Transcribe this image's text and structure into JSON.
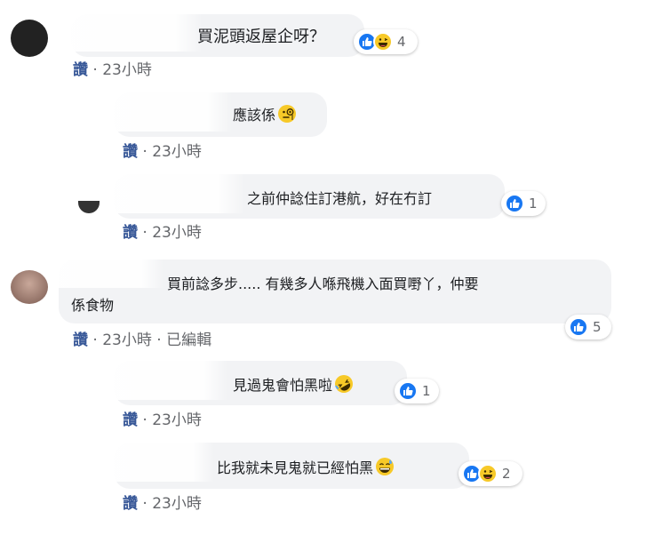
{
  "comments": [
    {
      "text": "買泥頭返屋企呀？",
      "reactions": [
        "like",
        "haha"
      ],
      "reaction_count": "4",
      "action": "讚",
      "sep": "·",
      "time": "23小時",
      "edited": ""
    },
    {
      "text": "應該係",
      "emoji": "monocle-face-emoji",
      "action": "讚",
      "sep": "·",
      "time": "23小時"
    },
    {
      "text": "之前仲諗住訂港航，好在冇訂",
      "reactions": [
        "like"
      ],
      "reaction_count": "1",
      "action": "讚",
      "sep": "·",
      "time": "23小時"
    },
    {
      "text_line1": "買前諗多步..... 有幾多人喺飛機入面買嘢丫，仲要",
      "text_line2": "係食物",
      "reactions": [
        "like"
      ],
      "reaction_count": "5",
      "action": "讚",
      "sep": "·",
      "time": "23小時",
      "sep2": "·",
      "edited": "已編輯"
    },
    {
      "text": "見過鬼會怕黑啦",
      "emoji": "rolling-laughing-emoji",
      "reactions": [
        "like"
      ],
      "reaction_count": "1",
      "action": "讚",
      "sep": "·",
      "time": "23小時"
    },
    {
      "text": "比我就未見鬼就已經怕黑",
      "emoji": "grinning-sweat-emoji",
      "reactions": [
        "like",
        "haha"
      ],
      "reaction_count": "2",
      "action": "讚",
      "sep": "·",
      "time": "23小時"
    }
  ],
  "colors": {
    "bubble": "#f2f3f5",
    "link": "#385898",
    "meta": "#65676b",
    "like": "#1877f2",
    "haha": "#f7c928"
  }
}
